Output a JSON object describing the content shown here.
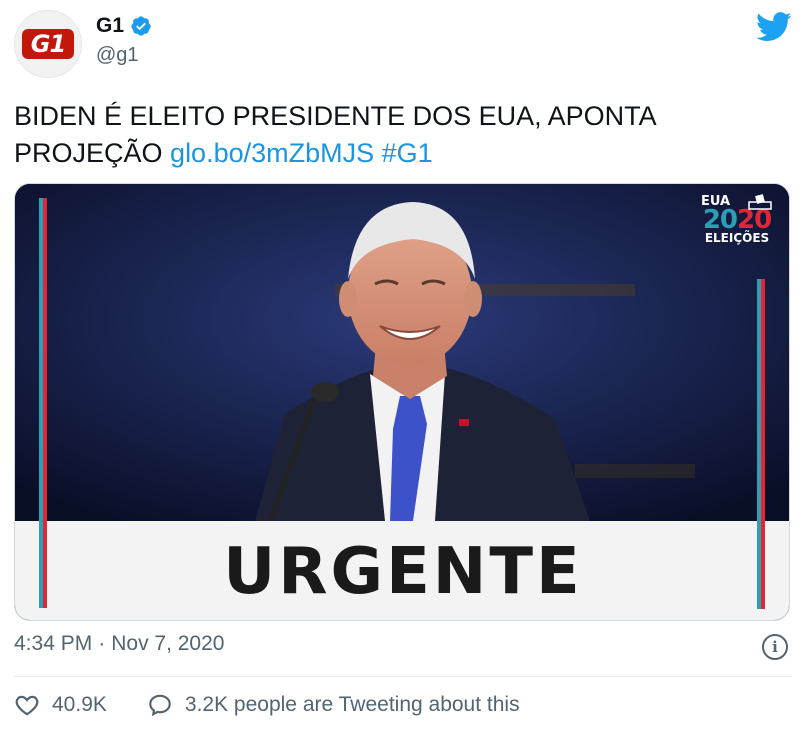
{
  "account": {
    "display_name": "G1",
    "handle": "@g1",
    "avatar_text": "G1",
    "verified": true
  },
  "tweet": {
    "text": "BIDEN É ELEITO PRESIDENTE DOS EUA, APONTA PROJEÇÃO",
    "link": "glo.bo/3mZbMJS",
    "hashtag": "#G1"
  },
  "media": {
    "banner_text": "URGENTE",
    "badge": {
      "top": "EUA",
      "year_part1": "20",
      "year_part2": "20",
      "bottom": "ELEIÇÕES"
    }
  },
  "meta": {
    "time": "4:34 PM",
    "separator": "·",
    "date": "Nov 7, 2020",
    "info_icon_glyph": "i"
  },
  "actions": {
    "likes": "40.9K",
    "conversation": "3.2K people are Tweeting about this"
  },
  "colors": {
    "link": "#1b95e0",
    "verified": "#1d9bf0",
    "brand_red": "#c4170c",
    "stripe_cyan": "#2b9fb5",
    "stripe_red": "#e32636"
  },
  "icons": [
    "verified-badge-icon",
    "twitter-bird-icon",
    "info-icon",
    "heart-icon",
    "comment-bubble-icon",
    "ballot-box-icon"
  ]
}
